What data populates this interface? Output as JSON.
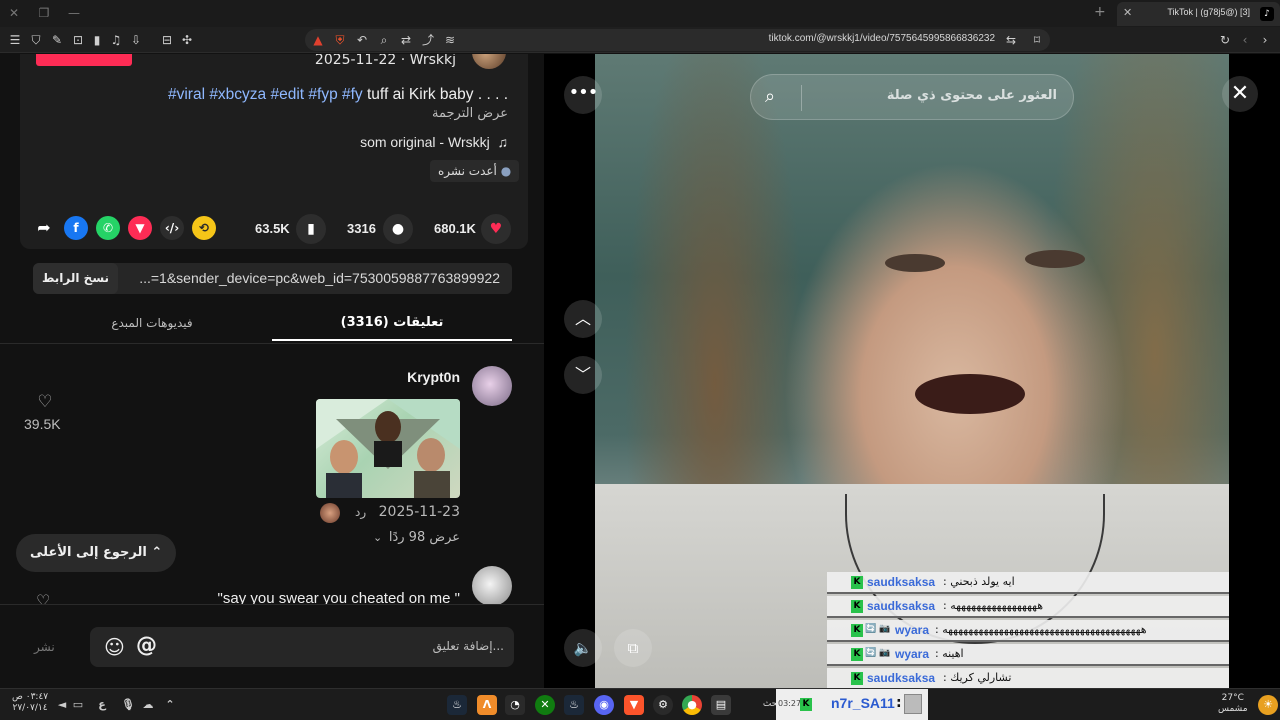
{
  "browser": {
    "tab_title": "TikTok | (g78j5@) [3]",
    "url": "tiktok.com/@wrskkj1/video/7575645995866836232"
  },
  "post": {
    "date_author": "2025-11-22 · Wrskkj",
    "caption_text": "tuff ai Kirk baby . . . .",
    "caption_tags": "#viral #xbcyza #edit #fyp #fy",
    "translate_label": "عرض الترجمة",
    "music": "som original - Wrskkj",
    "reposted_label": "أعدت نشره"
  },
  "actions": {
    "likes": "680.1K",
    "comments": "3316",
    "saves": "63.5K"
  },
  "link": {
    "copy_label": "نسخ الرابط",
    "text": "...=1&sender_device=pc&web_id=7530059887763899922"
  },
  "tabs": {
    "comments": "تعليقات (3316)",
    "creator_videos": "فيديوهات المبدع"
  },
  "comments": [
    {
      "user": "Krypt0n",
      "date": "2025-11-23",
      "reply_label": "رد",
      "view_replies": "عرض 98 ردًا",
      "likes": "39.5K"
    },
    {
      "text": "\"say you swear you cheated on me \""
    }
  ],
  "back_to_top": "الرجوع إلى الأعلى",
  "comment_input": {
    "placeholder": "إضافة تعليق...",
    "post_label": "نشر"
  },
  "video": {
    "search_placeholder": "العثور على محتوى ذي صلة"
  },
  "chat_overlay": [
    {
      "user": "saudksaksa",
      "badges": "",
      "message": ": ايه يولد ذبحني"
    },
    {
      "user": "saudksaksa",
      "badges": "",
      "message": ": هههههههههههههههههه"
    },
    {
      "user": "wyara",
      "badges": "🔄 📷 ",
      "message": ": هههههههههههههههههههههههههههههههههههههههه"
    },
    {
      "user": "wyara",
      "badges": "🔄 📷 ",
      "message": ": اهينه"
    },
    {
      "user": "saudksaksa",
      "badges": "",
      "message": ": تشارلي كريك"
    }
  ],
  "taskbar": {
    "time": "٠٣:٤٧ ص",
    "date": "٢٧/٠٧/١٤",
    "search_label": "بحث",
    "weather_temp": "27°C",
    "weather_desc": "مشمس",
    "chat_user": "n7r_SA11",
    "chat_time": "03:27",
    "lang": "ع"
  },
  "colors": {
    "accent_red": "#fe2c55",
    "tag_blue": "#8fb8ff",
    "chat_user_blue": "#3a6ad8",
    "kick_green": "#29c24b"
  }
}
